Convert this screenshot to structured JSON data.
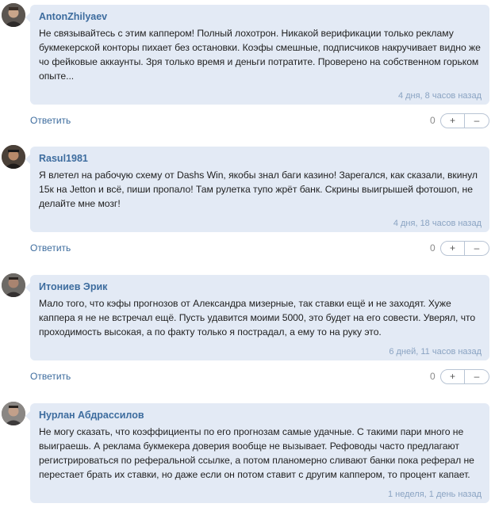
{
  "reply_label": "Ответить",
  "plus_label": "+",
  "minus_label": "–",
  "colors": {
    "bubble": "#e3eaf5",
    "author": "#3d6c9e",
    "time": "#8aa3c2"
  },
  "comments": [
    {
      "author": "AntonZhilyaev",
      "text": "Не связывайтесь с этим каппером! Полный лохотрон. Никакой верификации только рекламу букмекерской конторы пихает без остановки. Коэфы смешные, подписчиков накручивает видно же чо фейковые аккаунты. Зря только время и деньги потратите. Проверено на собственном горьком опыте...",
      "time": "4 дня, 8 часов назад",
      "score": "0"
    },
    {
      "author": "Rasul1981",
      "text": "Я влетел на рабочую схему от Dashs Win, якобы знал баги казино! Зарегался, как сказали, вкинул 15к на Jetton и всё, пиши пропало! Там рулетка тупо жрёт банк. Скрины выигрышей фотошоп, не делайте мне мозг!",
      "time": "4 дня, 18 часов назад",
      "score": "0"
    },
    {
      "author": "Итониев Эрик",
      "text": "Мало того, что кэфы прогнозов от Александра мизерные, так ставки ещё и не заходят. Хуже каппера я не не встречал ещё. Пусть удавится моими 5000, это будет на его совести. Уверял, что проходимость высокая, а по факту только я пострадал, а ему то на руку это.",
      "time": "6 дней, 11 часов назад",
      "score": "0"
    },
    {
      "author": "Нурлан Абдрассилов",
      "text": "Не могу сказать, что коэффициенты по его прогнозам самые удачные. С такими пари много не выиграешь. А реклама букмекера доверия вообще не вызывает. Рефоводы часто предлагают регистрироваться по реферальной ссылке, а потом планомерно сливают банки пока реферал не перестает брать их ставки, но даже если он потом ставит с другим каппером, то процент капает.",
      "time": "1 неделя, 1 день назад"
    }
  ]
}
